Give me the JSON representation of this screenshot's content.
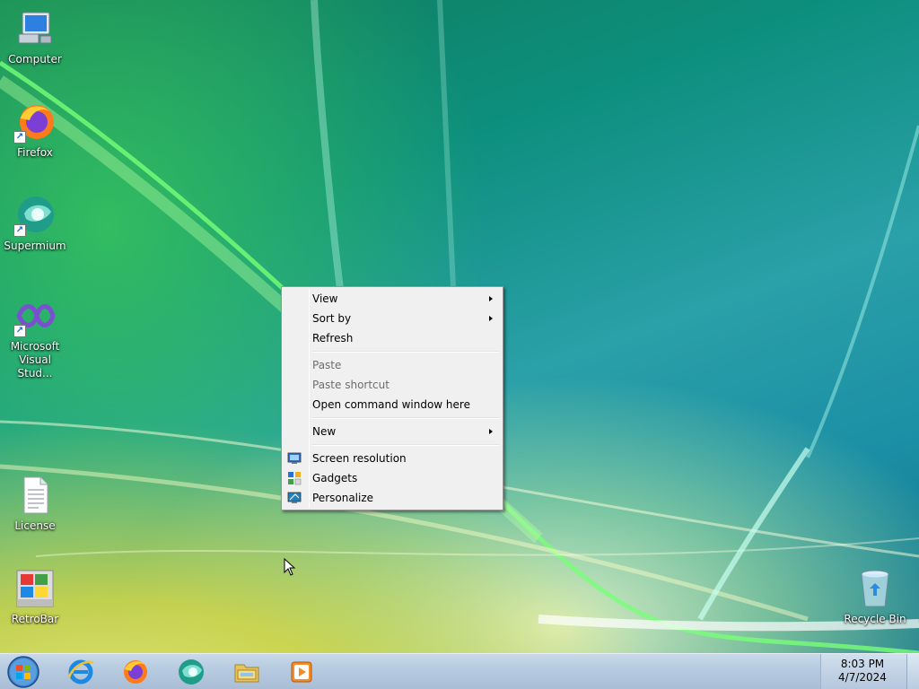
{
  "desktop": {
    "icons": [
      {
        "label": "Computer",
        "icon": "computer-icon"
      },
      {
        "label": "Firefox",
        "icon": "firefox-icon"
      },
      {
        "label": "Supermium",
        "icon": "supermium-icon"
      },
      {
        "label": "Microsoft Visual Stud...",
        "icon": "visual-studio-icon"
      },
      {
        "label": "License",
        "icon": "text-document-icon"
      },
      {
        "label": "RetroBar",
        "icon": "retrobar-icon"
      },
      {
        "label": "Recycle Bin",
        "icon": "recycle-bin-icon"
      }
    ]
  },
  "context_menu": {
    "items": [
      {
        "label": "View",
        "submenu": true,
        "enabled": true
      },
      {
        "label": "Sort by",
        "submenu": true,
        "enabled": true
      },
      {
        "label": "Refresh",
        "enabled": true
      },
      {
        "label": "Paste",
        "enabled": false
      },
      {
        "label": "Paste shortcut",
        "enabled": false
      },
      {
        "label": "Open command window here",
        "enabled": true
      },
      {
        "label": "New",
        "submenu": true,
        "enabled": true
      },
      {
        "label": "Screen resolution",
        "icon": "screen-resolution-icon",
        "enabled": true
      },
      {
        "label": "Gadgets",
        "icon": "gadgets-icon",
        "enabled": true
      },
      {
        "label": "Personalize",
        "icon": "personalize-icon",
        "enabled": true
      }
    ]
  },
  "taskbar": {
    "pinned": [
      {
        "icon": "internet-explorer-icon"
      },
      {
        "icon": "firefox-icon"
      },
      {
        "icon": "supermium-icon"
      },
      {
        "icon": "file-explorer-icon"
      },
      {
        "icon": "media-player-icon"
      }
    ],
    "clock": {
      "time": "8:03 PM",
      "date": "4/7/2024"
    }
  },
  "colors": {
    "menu_bg": "#f0f0f0",
    "menu_border": "#979797",
    "disabled_text": "#6d6d6d",
    "taskbar": "#b7cbe0"
  }
}
